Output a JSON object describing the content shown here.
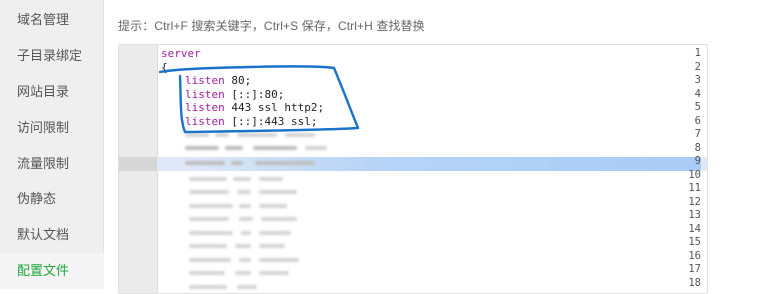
{
  "sidebar": {
    "items": [
      {
        "label": "域名管理",
        "active": false
      },
      {
        "label": "子目录绑定",
        "active": false
      },
      {
        "label": "网站目录",
        "active": false
      },
      {
        "label": "访问限制",
        "active": false
      },
      {
        "label": "流量限制",
        "active": false
      },
      {
        "label": "伪静态",
        "active": false
      },
      {
        "label": "默认文档",
        "active": false
      },
      {
        "label": "配置文件",
        "active": true
      }
    ]
  },
  "hint": "提示：Ctrl+F 搜索关键字，Ctrl+S 保存，Ctrl+H 查找替换",
  "editor": {
    "line_numbers": [
      "1",
      "2",
      "3",
      "4",
      "5",
      "6",
      "7",
      "8",
      "9",
      "10",
      "11",
      "12",
      "13",
      "14",
      "15",
      "16",
      "17",
      "18"
    ],
    "active_line": "9",
    "lines": [
      {
        "keyword": "server",
        "rest": ""
      },
      {
        "keyword": "",
        "rest": "{"
      },
      {
        "keyword": "listen",
        "rest": " 80;"
      },
      {
        "keyword": "listen",
        "rest": " [::]:80;"
      },
      {
        "keyword": "listen",
        "rest": " 443 ssl http2;"
      },
      {
        "keyword": "listen",
        "rest": " [::]:443 ssl;"
      }
    ]
  },
  "colors": {
    "accent": "#20a53a",
    "keyword": "#a020a0",
    "annotation": "#1a73c8"
  }
}
